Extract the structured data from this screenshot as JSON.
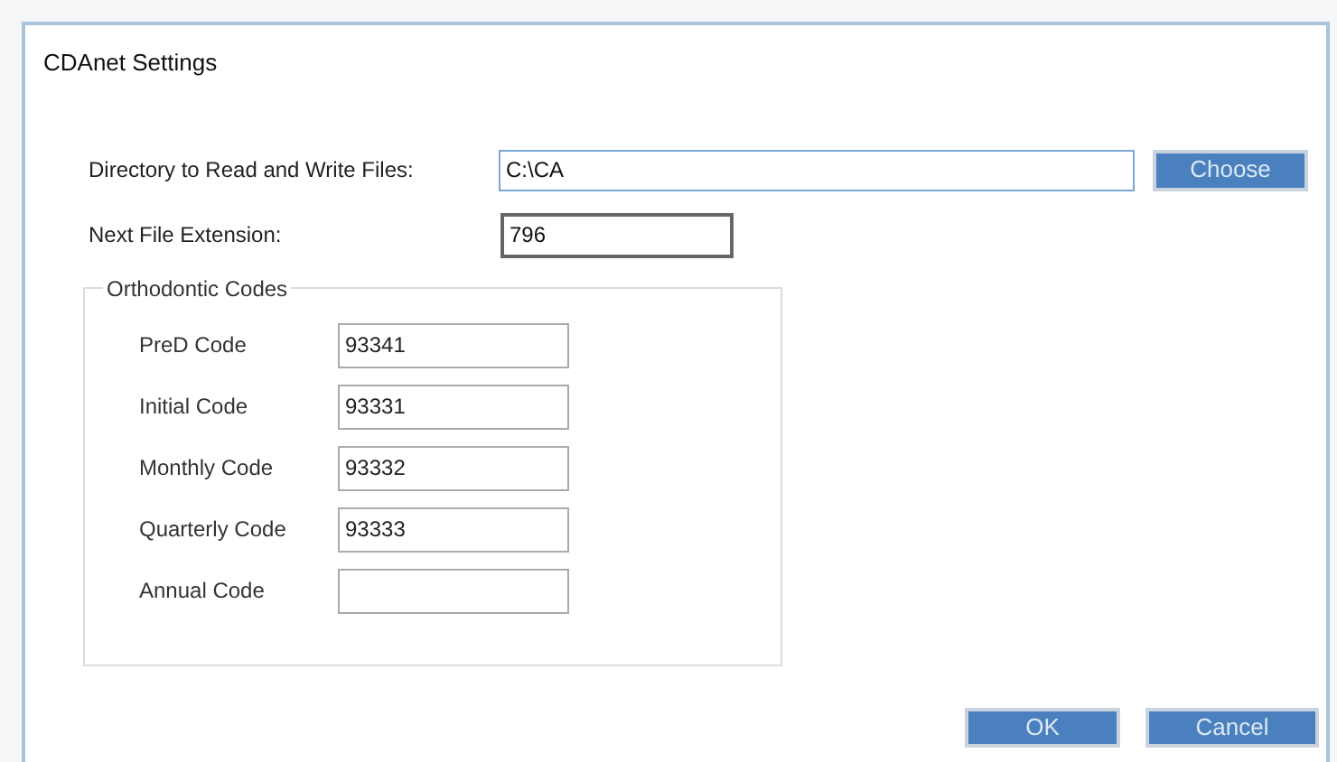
{
  "window": {
    "title": "CDAnet Settings"
  },
  "directory": {
    "label": "Directory to Read and Write Files:",
    "value": "C:\\CA",
    "focused": true,
    "button": "Choose"
  },
  "extension": {
    "label": "Next File Extension:",
    "value": "796"
  },
  "group": {
    "title": "Orthodontic Codes",
    "fields": [
      {
        "label": "PreD Code",
        "value": "93341"
      },
      {
        "label": "Initial Code",
        "value": "93331"
      },
      {
        "label": "Monthly Code",
        "value": "93332"
      },
      {
        "label": "Quarterly Code",
        "value": "93333"
      },
      {
        "label": "Annual Code"
      }
    ]
  },
  "buttons": [
    "OK",
    "Cancel"
  ]
}
